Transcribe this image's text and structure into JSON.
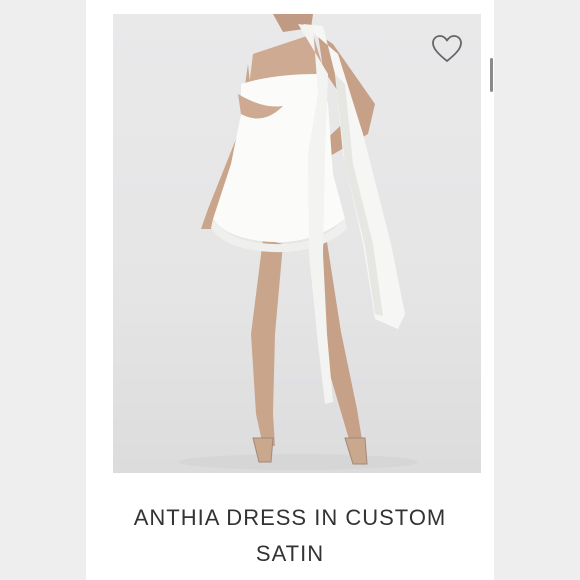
{
  "product": {
    "title_line1": "ANTHIA DRESS IN CUSTOM",
    "title_line2": "SATIN",
    "image_subject": "white one-shoulder satin mini dress with draped sash"
  },
  "icons": {
    "wishlist": "heart-outline-icon"
  },
  "colors": {
    "page_bg": "#ffffff",
    "side_bg": "#eeeeee",
    "text": "#333333"
  }
}
